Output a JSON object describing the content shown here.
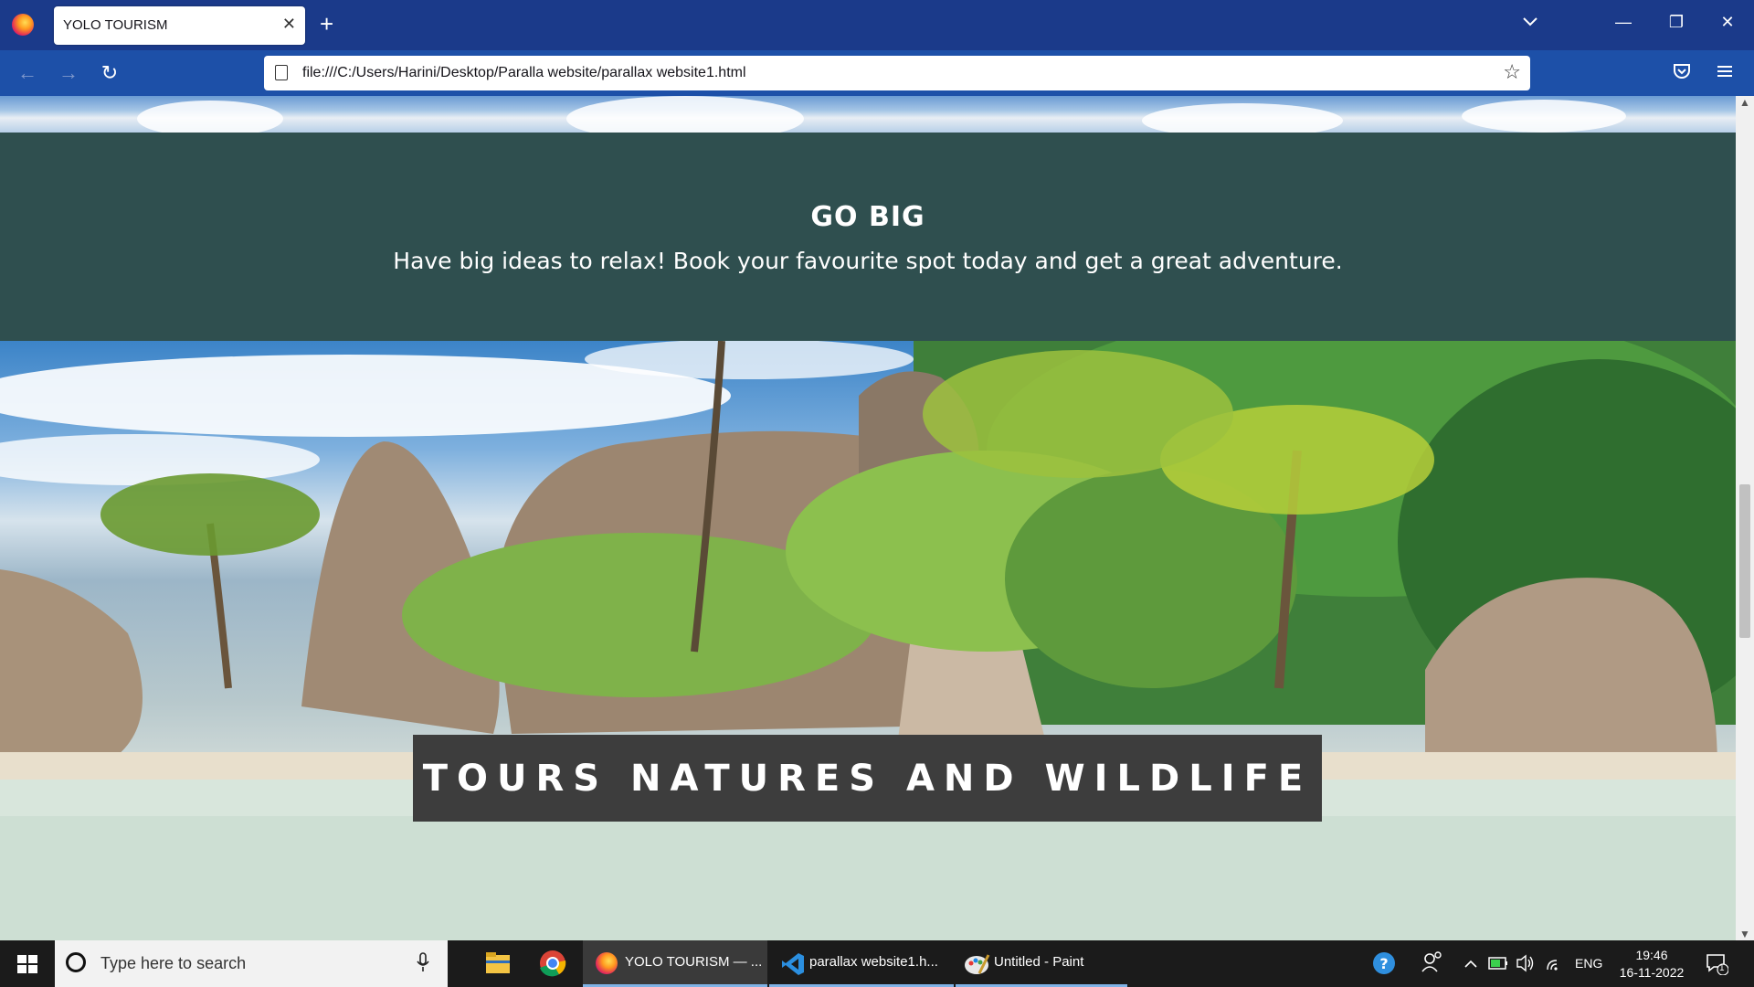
{
  "browser": {
    "tab_title": "YOLO TOURISM",
    "tab_close": "✕",
    "new_tab": "+",
    "url": "file:///C:/Users/Harini/Desktop/Paralla website/parallax website1.html",
    "back": "←",
    "forward": "→",
    "reload": "↻",
    "star": "☆",
    "minimize": "—",
    "restore": "❐",
    "close": "✕"
  },
  "page": {
    "section_heading": "GO BIG",
    "section_text": "Have big ideas to relax! Book your favourite spot today and get a great adventure.",
    "hero_title": "TOURS NATURES AND WILDLIFE"
  },
  "taskbar": {
    "search_placeholder": "Type here to search",
    "apps": [
      {
        "label": "YOLO TOURISM — ...",
        "icon": "firefox-icon"
      },
      {
        "label": "parallax website1.h...",
        "icon": "vscode-icon"
      },
      {
        "label": "Untitled - Paint",
        "icon": "paint-icon"
      }
    ],
    "lang": "ENG",
    "time": "19:46",
    "date": "16-11-2022",
    "notification_count": "1"
  },
  "colors": {
    "tabbar": "#1b3a8a",
    "navbar": "#1d50a8",
    "section_bg": "#2f4f4f",
    "hero_title_bg": "#3d3d3d",
    "taskbar": "#1b1b1b"
  }
}
